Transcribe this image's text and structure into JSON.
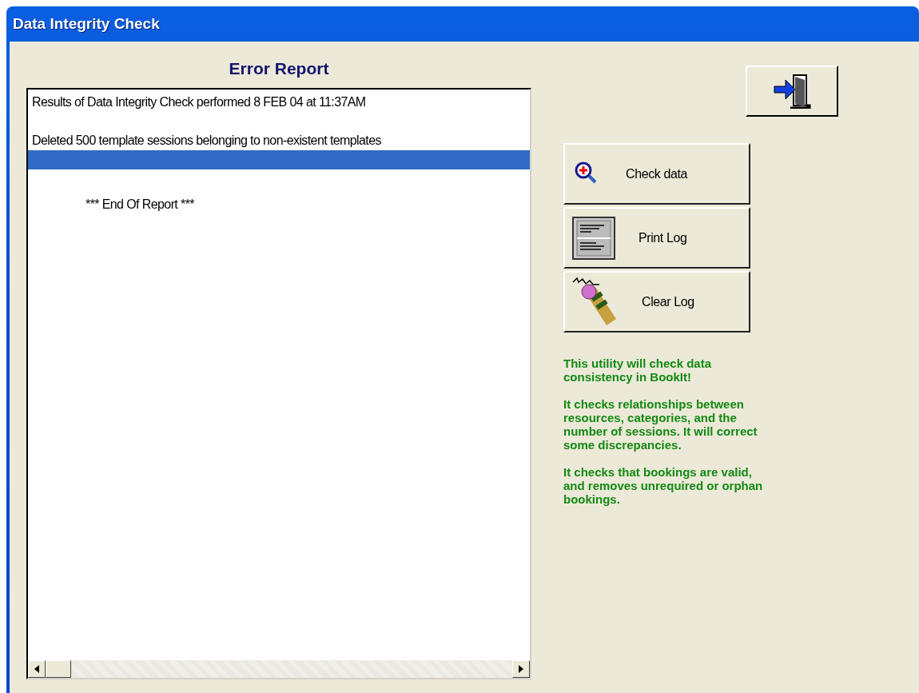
{
  "window": {
    "title": "Data Integrity Check"
  },
  "report": {
    "heading": "Error Report",
    "lines": [
      {
        "kind": "header",
        "text": "Results of Data Integrity Check performed  8 FEB 04 at 11:37AM",
        "selected": false
      },
      {
        "kind": "text",
        "text": "Deleted 500 template sessions belonging to non-existent templates",
        "selected": false
      },
      {
        "kind": "blank",
        "selected": true
      },
      {
        "kind": "indented",
        "text": "***  End Of Report  ***",
        "selected": false
      }
    ]
  },
  "buttons": [
    {
      "kind": "check",
      "label": "Check data"
    },
    {
      "kind": "print",
      "label": "Print Log"
    },
    {
      "kind": "clear",
      "label": "Clear Log"
    }
  ],
  "info": [
    "This utility will check data consistency in BookIt!",
    "It checks relationships between resources, categories, and the number of sessions.  It will correct some discrepancies.",
    "It checks that bookings are valid, and removes unrequired or orphan bookings."
  ]
}
